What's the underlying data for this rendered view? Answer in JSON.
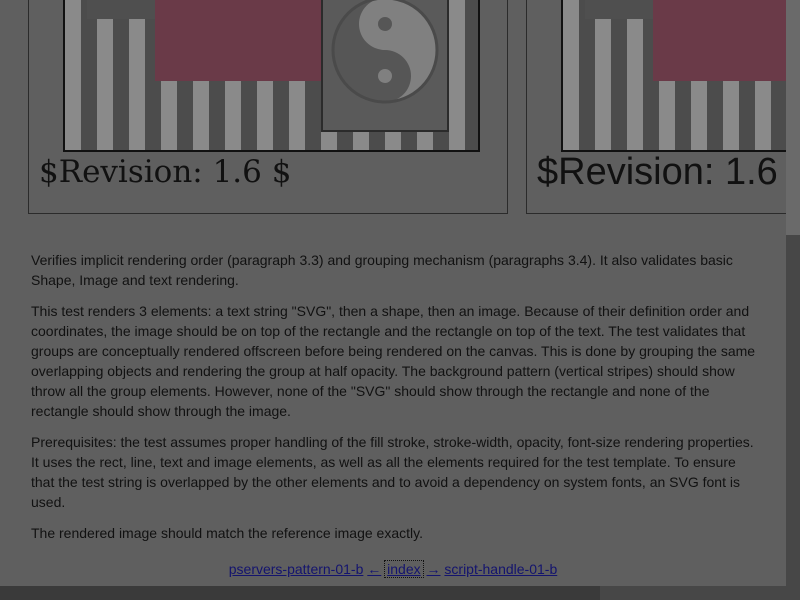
{
  "test_images": {
    "left_revision": "$Revision: 1.6 $",
    "right_revision": "$Revision: 1.6"
  },
  "description": {
    "p1": "Verifies implicit rendering order (paragraph 3.3) and grouping mechanism (paragraphs 3.4). It also validates basic Shape, Image and text rendering.",
    "p2": "This test renders 3 elements: a text string \"SVG\", then a shape, then an image. Because of their definition order and coordinates, the image should be on top of the rectangle and the rectangle on top of the text. The test validates that groups are conceptually rendered offscreen before being rendered on the canvas. This is done by grouping the same overlapping objects and rendering the group at half opacity. The background pattern (vertical stripes) should show throw all the group elements. However, none of the \"SVG\" should show through the rectangle and none of the rectangle should show through the image.",
    "p3": "Prerequisites: the test assumes proper handling of the fill stroke, stroke-width, opacity, font-size rendering properties. It uses the rect, line, text and image elements, as well as all the elements required for the test template. To ensure that the test string is overlapped by the other elements and to avoid a dependency on system fonts, an SVG font is used.",
    "p4": "The rendered image should match the reference image exactly."
  },
  "nav": {
    "prev": "pservers-pattern-01-b",
    "prev_arrow": "←",
    "index": "index",
    "next_arrow": "→",
    "next": "script-handle-01-b"
  },
  "icons": [
    "yin-yang-icon"
  ]
}
